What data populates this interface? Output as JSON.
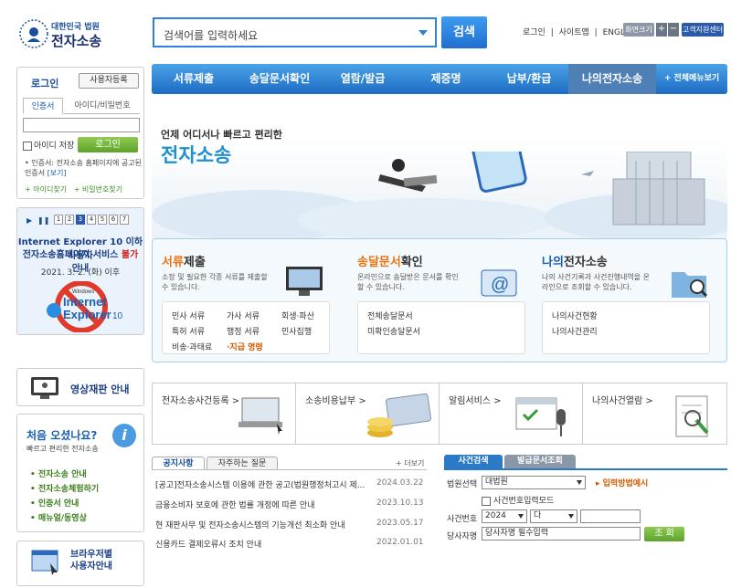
{
  "logo": {
    "org": "대한민국 법원",
    "name": "전자소송"
  },
  "search": {
    "placeholder": "검색어를 입력하세요",
    "button": "검색"
  },
  "toplinks": [
    "로그인",
    "|",
    "사이트맵",
    "|",
    "ENGLISH"
  ],
  "zoom": {
    "label": "화면크기",
    "plus": "+",
    "minus": "−"
  },
  "support": "고객지원센터",
  "nav": [
    "서류제출",
    "송달문서확인",
    "열람/발급",
    "제증명",
    "납부/환급",
    "나의전자소송",
    "+ 전체메뉴보기"
  ],
  "login": {
    "title": "로그인",
    "register": "사용자등록",
    "tab_cert": "인증서",
    "tab_id": "아이디/비밀번호",
    "keep": "아이디 저장",
    "button": "로그인",
    "note": "• 인증서: 전자소송 홈페이지에 공고된 인증서",
    "note_link": "[보기]",
    "find_id": "+ 아이디찾기",
    "find_pw": "+ 비밀번호찾기"
  },
  "banner": {
    "pages": [
      "1",
      "2",
      "3",
      "4",
      "5",
      "6",
      "7"
    ],
    "line1": "Internet Explorer 10 이하 사용자",
    "line2a": "전자소송홈페이지 서비스 ",
    "line2b": "불가",
    "line2c": " 안내",
    "date": "2021. 3. 2. (화) 이후",
    "ie_small": "Windows",
    "ie_big1": "Internet",
    "ie_big2": "Explorer",
    "ie_ver": "10"
  },
  "video": "영상재판 안내",
  "first": {
    "title": "처음 오셨나요?",
    "sub": "빠르고 편리한 전자소송",
    "items": [
      "전자소송 안내",
      "전자소송체험하기",
      "인증서 안내",
      "매뉴얼/동영상"
    ]
  },
  "browser": {
    "l1": "브라우저별",
    "l2": "사용자안내"
  },
  "hero": {
    "line1": "언제 어디서나 빠르고 편리한",
    "line2": "전자소송"
  },
  "services": [
    {
      "a": "서류",
      "b": "제출",
      "desc": "소장 및 필요한 각종 서류를 제출할 수 있습니다.",
      "items": [
        "민사 서류",
        "가사 서류",
        "회생·파산",
        "특허 서류",
        "행정 서류",
        "민사집행",
        "비송·과태료",
        "·지급 명령"
      ]
    },
    {
      "a": "송달문서",
      "b": "확인",
      "desc": "온라인으로 송달받은 문서를 확인 할 수 있습니다.",
      "items": [
        "전체송달문서",
        "미확인송달문서"
      ]
    },
    {
      "a": "나의",
      "b": "전자소송",
      "desc": "나의 사건기록과 사건진행내역을 온라인으로 조회할 수 있습니다.",
      "items": [
        "나의사건현황",
        "나의사건관리"
      ]
    }
  ],
  "quick": [
    "전자소송사건등록 >",
    "소송비용납부 >",
    "알림서비스 >",
    "나의사건열람 >"
  ],
  "notice": {
    "tab1": "공지사항",
    "tab2": "자주하는 질문",
    "more": "+ 더보기",
    "items": [
      {
        "t": "[공고]전자소송시스템 이용에 관한 공고(법원행정처고시 제...",
        "d": "2024.03.22"
      },
      {
        "t": "금융소비자 보호에 관한 법률 개정에 따른 안내",
        "d": "2023.10.13"
      },
      {
        "t": "현 재판사무 및 전자소송시스템의 기능개선 최소화 안내",
        "d": "2023.05.17"
      },
      {
        "t": "신용카드 결제오류시 조치 안내",
        "d": "2022.01.01"
      }
    ]
  },
  "case": {
    "tab1": "사건검색",
    "tab2": "발급문서조회",
    "court_label": "법원선택",
    "court_value": "대법원",
    "input_method": "입력방법예시",
    "mode": "사건번호입력모드",
    "no_label": "사건번호",
    "year": "2024",
    "type": "다",
    "party_label": "당사자명",
    "party_value": "당사자명 필수입력",
    "button": "조 회"
  },
  "colors": {
    "accent": "#1d6cc4",
    "orange": "#e87512",
    "green": "#5ea32a"
  }
}
